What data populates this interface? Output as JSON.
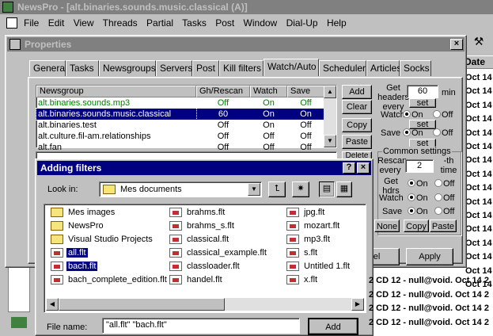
{
  "app": {
    "title": "NewsPro - [alt.binaries.sounds.music.classical (A)]",
    "menu": [
      "File",
      "Edit",
      "View",
      "Threads",
      "Partial",
      "Tasks",
      "Post",
      "Window",
      "Dial-Up",
      "Help"
    ]
  },
  "right_list": {
    "header": "Date",
    "dates": [
      "Oct 14 2",
      "Oct 14 2",
      "Oct 14 2",
      "Oct 14 2",
      "Oct 14 2",
      "Oct 14 2",
      "Oct 14 2",
      "Oct 14 2",
      "Oct 14 2",
      "Oct 14 2",
      "Oct 14 2",
      "Oct 14 2",
      "Oct 14 2",
      "Oct 14 2",
      "Oct 14 2",
      "Oct 14 2"
    ],
    "bottom_rows": [
      "2 CD 12 - null@void. Oct 14 2",
      "2 CD 12 - null@void. Oct 14 2",
      "2 CD 12 - null@void. Oct 14 2",
      "2 CD 12 - null@void. Oct 14 2"
    ]
  },
  "properties": {
    "title": "Properties",
    "tabs": [
      "General",
      "Tasks",
      "Newsgroups",
      "Servers",
      "Post",
      "Kill filters",
      "Watch/Auto",
      "Scheduler",
      "Articles",
      "Socks"
    ],
    "selected_tab": "Watch/Auto",
    "columns": [
      "Newsgroup",
      "Gh/Rescan",
      "Watch",
      "Save"
    ],
    "rows": [
      {
        "name": "alt.binaries.sounds.mp3",
        "rescan": "Off",
        "watch": "On",
        "save": "Off",
        "color": "#008000"
      },
      {
        "name": "alt.binaries.sounds.music.classical",
        "rescan": "60",
        "watch": "On",
        "save": "On",
        "selected": true
      },
      {
        "name": "alt.binaries.test",
        "rescan": "Off",
        "watch": "On",
        "save": "Off"
      },
      {
        "name": "alt.culture.fil-am.relationships",
        "rescan": "Off",
        "watch": "Off",
        "save": "Off"
      },
      {
        "name": "alt.fan",
        "rescan": "Off",
        "watch": "Off",
        "save": "Off"
      }
    ],
    "buttons": {
      "add": "Add",
      "clear": "Clear",
      "copy": "Copy",
      "paste": "Paste",
      "delete": "Delete",
      "none": "None",
      "copy2": "Copy",
      "paste2": "Paste",
      "cancel": "el",
      "apply": "Apply"
    },
    "get_headers": {
      "label": "Get headers every",
      "value": "60",
      "unit": "min",
      "set": "set"
    },
    "watch_label": "Watch",
    "save_label": "Save",
    "on": "On",
    "off": "Off",
    "common": {
      "label": "Common settings",
      "rescan_label": "Rescan every",
      "rescan_value": "2",
      "rescan_unit": "-th time",
      "get_hdrs": "Get hdrs",
      "watch": "Watch",
      "save": "Save"
    }
  },
  "dialog": {
    "title": "Adding filters",
    "look_in_label": "Look in:",
    "look_in_value": "Mes documents",
    "files": [
      {
        "name": "Mes images",
        "type": "folder"
      },
      {
        "name": "NewsPro",
        "type": "folder"
      },
      {
        "name": "Visual Studio Projects",
        "type": "folder"
      },
      {
        "name": "all.flt",
        "type": "flt",
        "selected": true
      },
      {
        "name": "bach.flt",
        "type": "flt",
        "selected": true
      },
      {
        "name": "bach_complete_edition.flt",
        "type": "flt"
      },
      {
        "name": "brahms.flt",
        "type": "flt"
      },
      {
        "name": "brahms_s.flt",
        "type": "flt"
      },
      {
        "name": "classical.flt",
        "type": "flt"
      },
      {
        "name": "classical_example.flt",
        "type": "flt"
      },
      {
        "name": "classloader.flt",
        "type": "flt"
      },
      {
        "name": "handel.flt",
        "type": "flt"
      },
      {
        "name": "jpg.flt",
        "type": "flt"
      },
      {
        "name": "mozart.flt",
        "type": "flt"
      },
      {
        "name": "mp3.flt",
        "type": "flt"
      },
      {
        "name": "s.flt",
        "type": "flt"
      },
      {
        "name": "Untitled 1.flt",
        "type": "flt"
      },
      {
        "name": "x.flt",
        "type": "flt"
      }
    ],
    "filename_label": "File name:",
    "filename_value": "\"all.flt\" \"bach.flt\"",
    "add_button": "Add"
  }
}
